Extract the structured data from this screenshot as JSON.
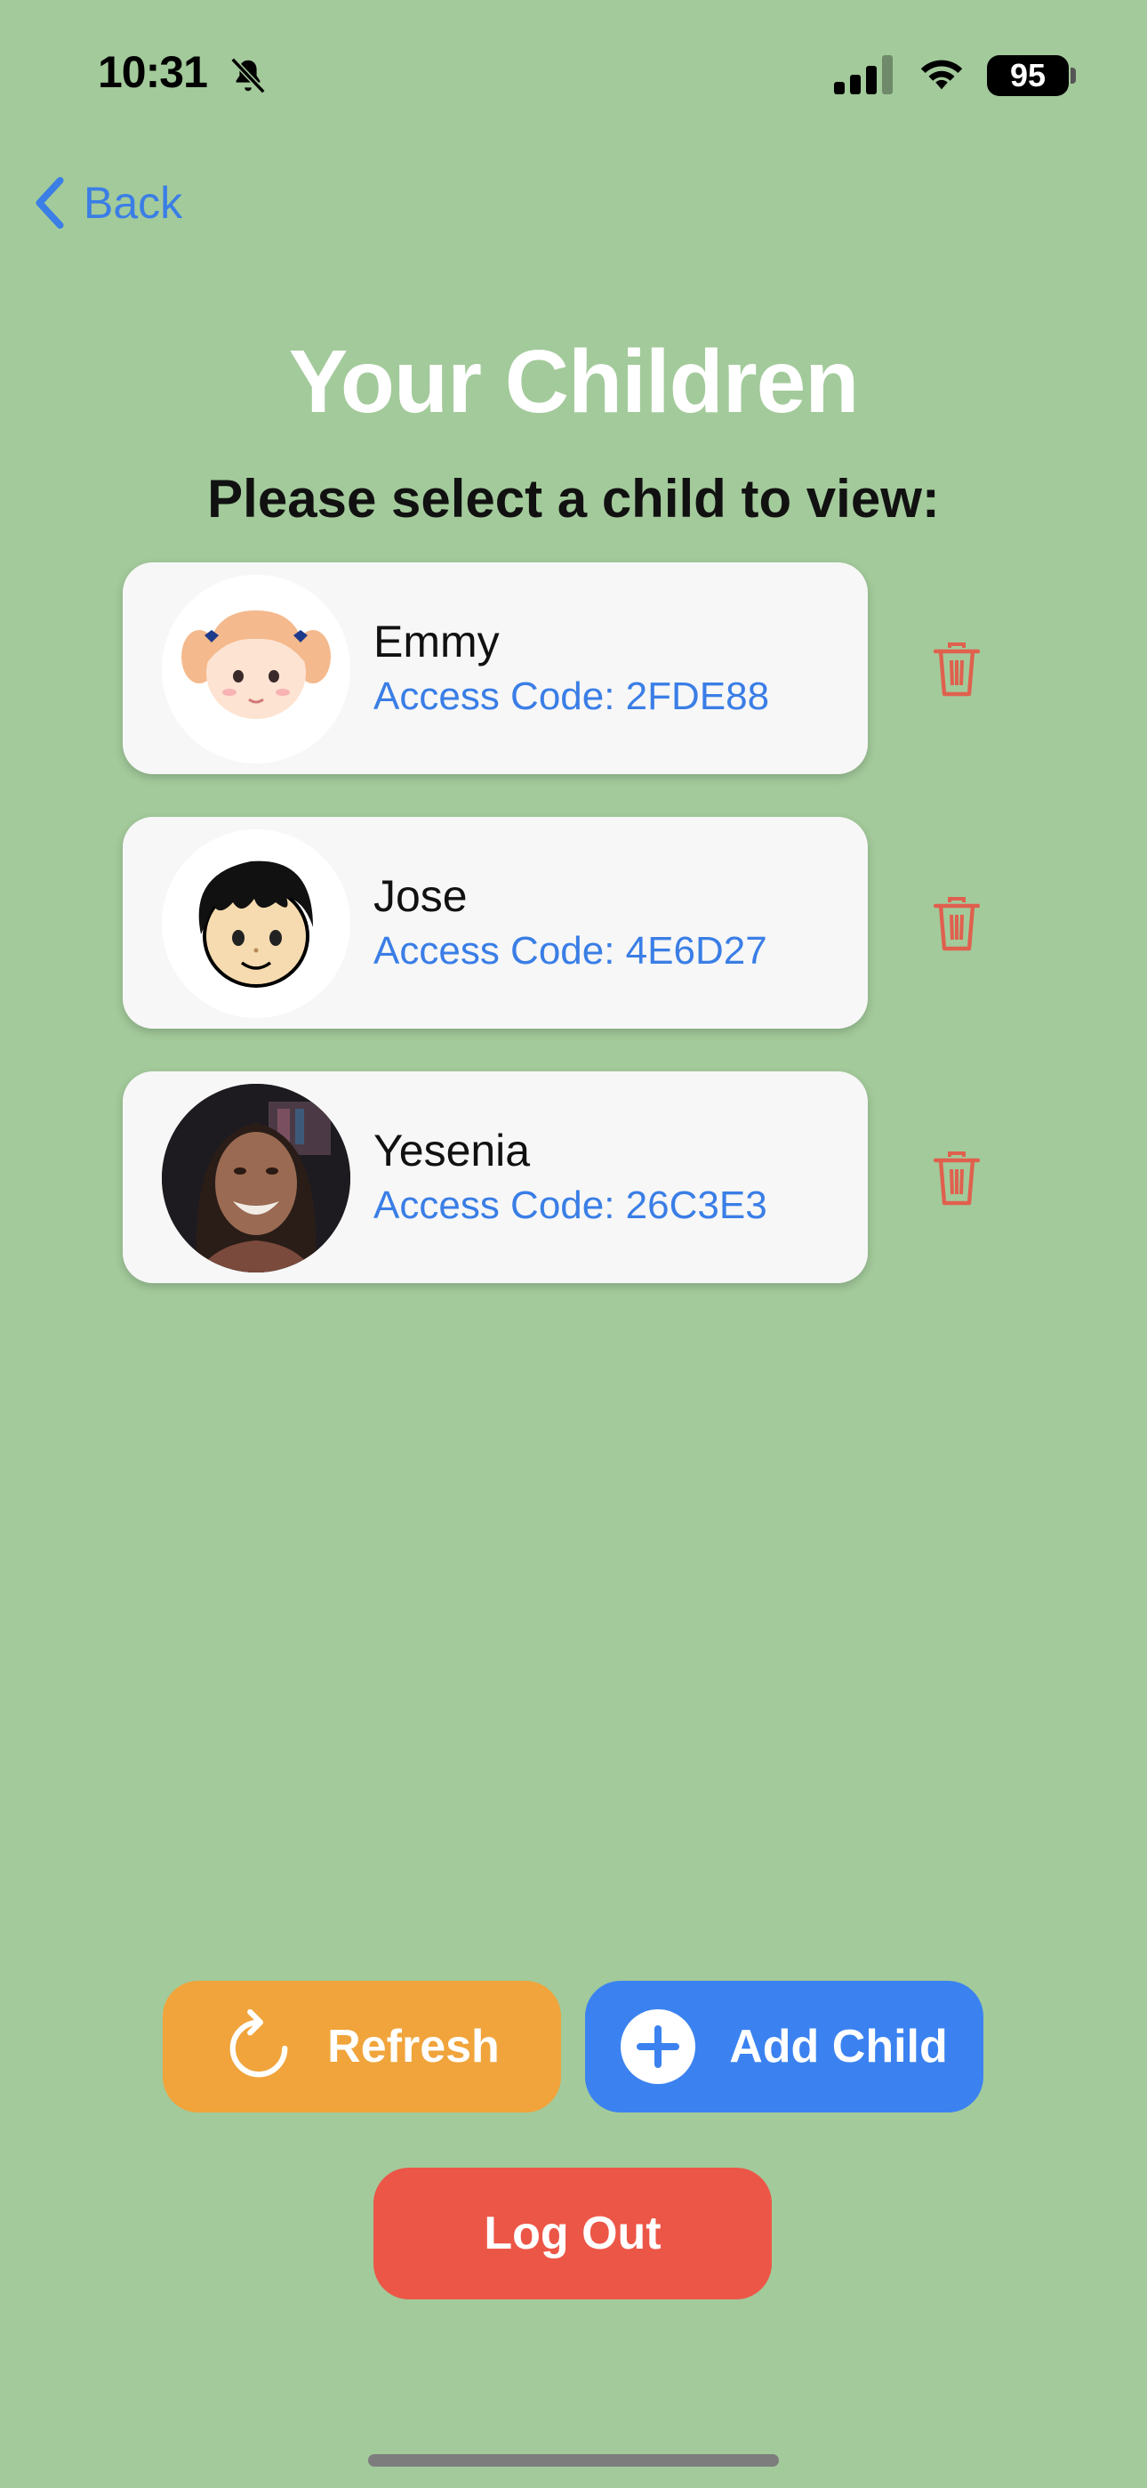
{
  "status_bar": {
    "time": "10:31",
    "battery": "95"
  },
  "nav": {
    "back_label": "Back"
  },
  "page": {
    "title": "Your Children",
    "subtitle": "Please select a child to view:"
  },
  "children": [
    {
      "name": "Emmy",
      "access_code": "Access Code: 2FDE88",
      "avatar": "cartoon-girl-avatar"
    },
    {
      "name": "Jose",
      "access_code": "Access Code: 4E6D27",
      "avatar": "cartoon-boy-avatar"
    },
    {
      "name": "Yesenia",
      "access_code": "Access Code: 26C3E3",
      "avatar": "photo-avatar"
    }
  ],
  "actions": {
    "refresh_label": "Refresh",
    "add_child_label": "Add Child",
    "logout_label": "Log Out"
  },
  "colors": {
    "background": "#a3ca9b",
    "accent_blue": "#3b82f0",
    "refresh_orange": "#f0a43b",
    "logout_red": "#ec5647",
    "trash_red": "#e0604e"
  }
}
